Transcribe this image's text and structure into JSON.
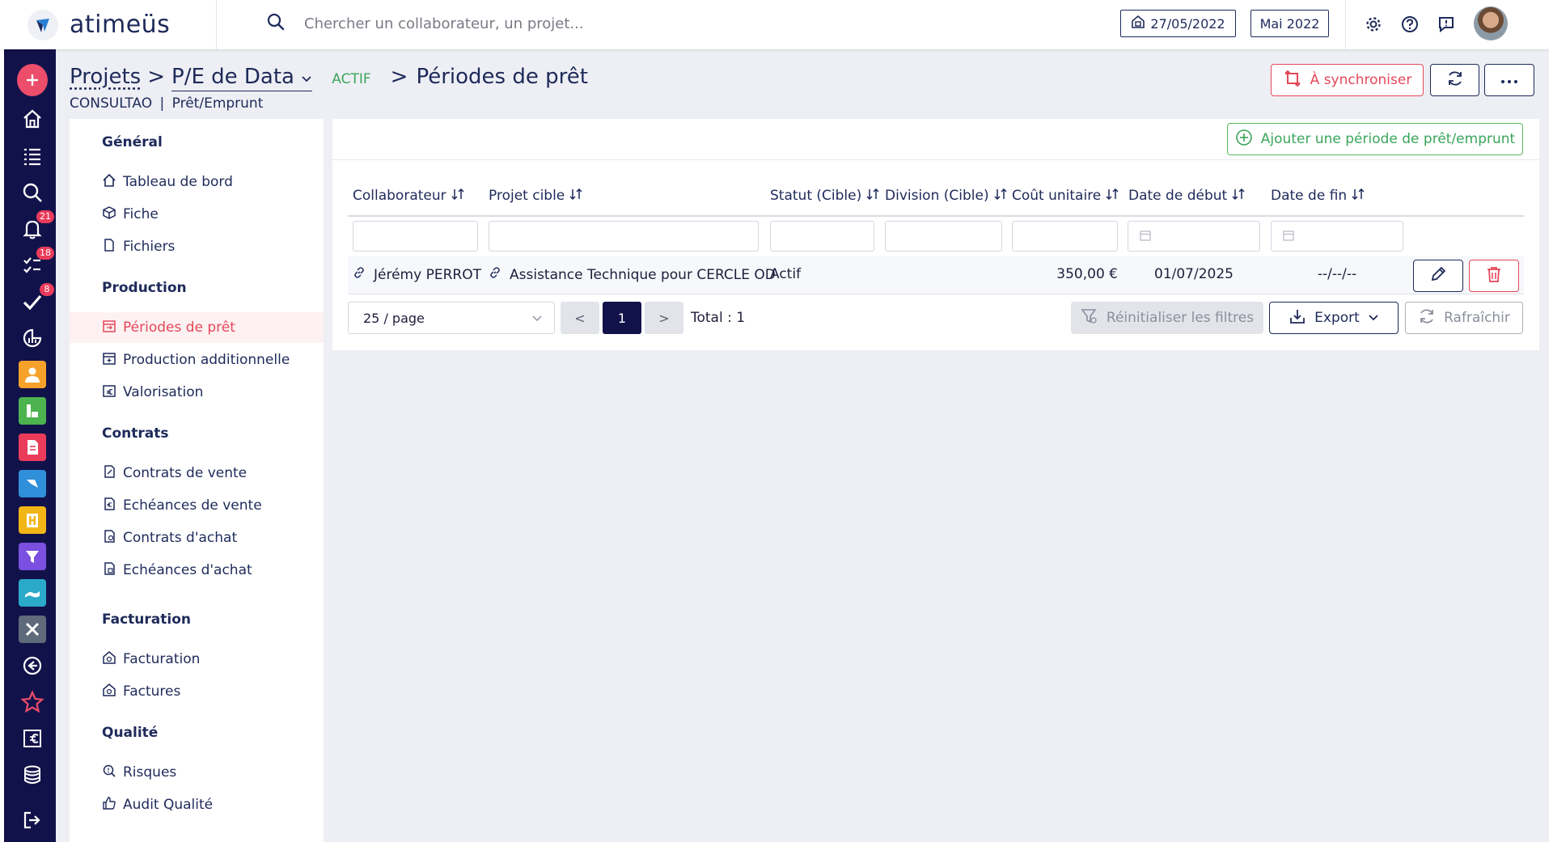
{
  "app": {
    "logo_text": "atimeüs"
  },
  "search": {
    "placeholder": "Chercher un collaborateur, un projet..."
  },
  "header": {
    "date": "27/05/2022",
    "period": "Mai 2022"
  },
  "rail": {
    "badges": {
      "notifications": "21",
      "tasks": "18",
      "validations": "8"
    }
  },
  "breadcrumb": {
    "root": "Projets",
    "sep1": ">",
    "project": "P/E de Data",
    "status": "ACTIF",
    "sep2": ">",
    "page": "Périodes de prêt"
  },
  "subline": {
    "client": "CONSULTAO",
    "sep": "|",
    "type": "Prêt/Emprunt"
  },
  "actions": {
    "sync_label": "À synchroniser"
  },
  "sidenav": {
    "sections": [
      {
        "title": "Général",
        "items": [
          "Tableau de bord",
          "Fiche",
          "Fichiers"
        ]
      },
      {
        "title": "Production",
        "items": [
          "Périodes de prêt",
          "Production additionnelle",
          "Valorisation"
        ]
      },
      {
        "title": "Contrats",
        "items": [
          "Contrats de vente",
          "Echéances de vente",
          "Contrats d'achat",
          "Echéances d'achat"
        ]
      },
      {
        "title": "Facturation",
        "items": [
          "Facturation",
          "Factures"
        ]
      },
      {
        "title": "Qualité",
        "items": [
          "Risques",
          "Audit Qualité"
        ]
      }
    ],
    "active_item": "Périodes de prêt"
  },
  "main": {
    "add_label": "Ajouter une période de prêt/emprunt",
    "columns": [
      "Collaborateur",
      "Projet cible",
      "Statut (Cible)",
      "Division (Cible)",
      "Coût unitaire",
      "Date de début",
      "Date de fin"
    ],
    "rows": [
      {
        "collaborateur": "Jérémy PERROT",
        "projet": "Assistance Technique pour CERCLE OD",
        "statut": "Actif",
        "division": "",
        "cout": "350,00 €",
        "debut": "01/07/2025",
        "fin": "--/--/--"
      }
    ],
    "pagination": {
      "page_size": "25 / page",
      "prev": "<",
      "current": "1",
      "next": ">",
      "total_label": "Total : 1"
    },
    "reset_label": "Réinitialiser les filtres",
    "export_label": "Export",
    "refresh_label": "Rafraîchir"
  },
  "colors": {
    "navy": "#12124a",
    "accent_red": "#e5485a",
    "green": "#3aa55a"
  }
}
